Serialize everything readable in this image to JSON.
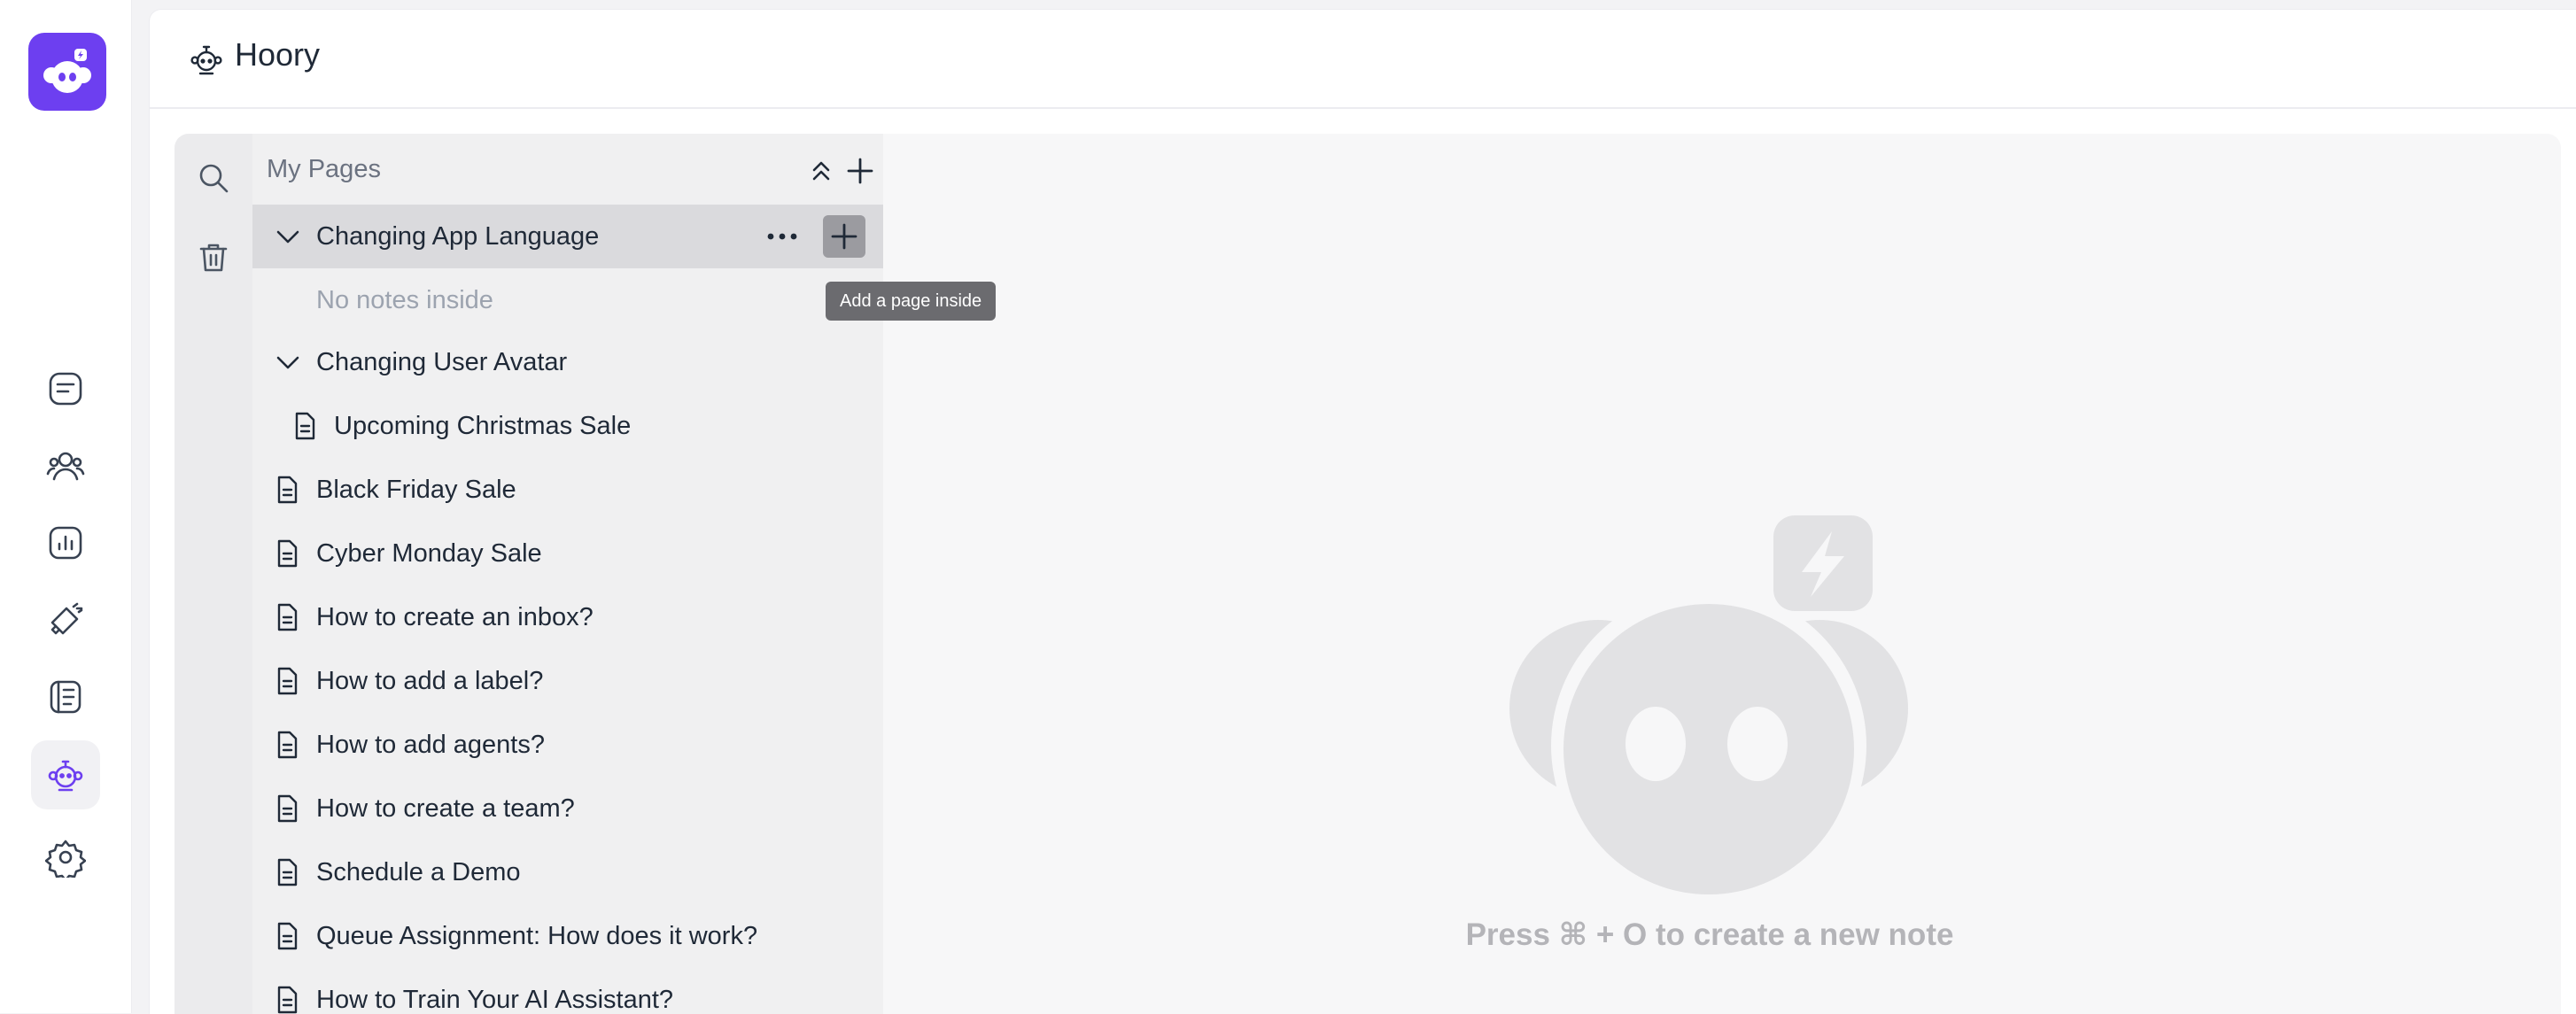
{
  "app": {
    "title": "Hoory",
    "accent": "#6d3ff0"
  },
  "rail": {
    "items": [
      {
        "icon": "conversations-icon"
      },
      {
        "icon": "contacts-icon"
      },
      {
        "icon": "reports-icon"
      },
      {
        "icon": "campaigns-icon"
      },
      {
        "icon": "library-icon"
      },
      {
        "icon": "bot-icon",
        "active": true
      },
      {
        "icon": "settings-icon"
      }
    ]
  },
  "notes": {
    "header_title": "My Pages",
    "tree": [
      {
        "label": "Changing App Language",
        "type": "folder",
        "expanded": true,
        "selected": true
      },
      {
        "label": "No notes inside",
        "type": "empty"
      },
      {
        "label": "Changing User Avatar",
        "type": "folder",
        "expanded": true
      },
      {
        "label": "Upcoming Christmas Sale",
        "type": "page",
        "nested": true
      },
      {
        "label": "Black Friday Sale",
        "type": "page"
      },
      {
        "label": "Cyber Monday Sale",
        "type": "page"
      },
      {
        "label": "How to create an inbox?",
        "type": "page"
      },
      {
        "label": "How to add a label?",
        "type": "page"
      },
      {
        "label": "How to add agents?",
        "type": "page"
      },
      {
        "label": "How to create a team?",
        "type": "page"
      },
      {
        "label": "Schedule a Demo",
        "type": "page"
      },
      {
        "label": "Queue Assignment: How does it work?",
        "type": "page"
      },
      {
        "label": "How to Train Your AI Assistant?",
        "type": "page"
      }
    ],
    "tooltip": "Add a page inside",
    "empty_message": "Press ⌘ + O to create a new note"
  }
}
